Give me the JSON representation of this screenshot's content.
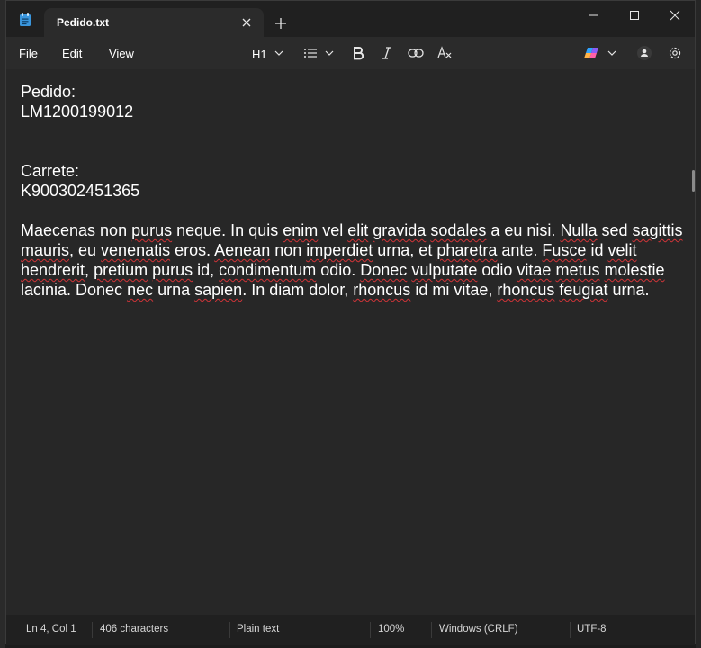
{
  "window": {
    "tab_title": "Pedido.txt"
  },
  "menu": {
    "file": "File",
    "edit": "Edit",
    "view": "View"
  },
  "toolbar": {
    "heading": "H1",
    "icons": [
      "list-icon",
      "bold-icon",
      "italic-icon",
      "link-icon",
      "clear-format-icon",
      "copilot-icon",
      "account-icon",
      "settings-icon"
    ]
  },
  "document": {
    "line1": "Pedido:",
    "line2": "LM1200199012",
    "line3": "Carrete:",
    "line4": "K900302451365",
    "paragraph": [
      {
        "t": "Maecenas non ",
        "sq": false
      },
      {
        "t": "purus",
        "sq": true
      },
      {
        "t": " neque. In quis ",
        "sq": false
      },
      {
        "t": "enim",
        "sq": true
      },
      {
        "t": " vel ",
        "sq": false
      },
      {
        "t": "elit",
        "sq": true
      },
      {
        "t": " ",
        "sq": false
      },
      {
        "t": "gravida",
        "sq": true
      },
      {
        "t": " ",
        "sq": false
      },
      {
        "t": "sodales",
        "sq": true
      },
      {
        "t": " a eu nisi. ",
        "sq": false
      },
      {
        "t": "Nulla",
        "sq": true
      },
      {
        "t": " sed ",
        "sq": false
      },
      {
        "t": "sagittis",
        "sq": true
      },
      {
        "t": " ",
        "sq": false
      },
      {
        "t": "mauris",
        "sq": true
      },
      {
        "t": ", eu ",
        "sq": false
      },
      {
        "t": "venenatis",
        "sq": true
      },
      {
        "t": " eros. ",
        "sq": false
      },
      {
        "t": "Aenean",
        "sq": true
      },
      {
        "t": " non ",
        "sq": false
      },
      {
        "t": "imperdiet",
        "sq": true
      },
      {
        "t": " urna, et ",
        "sq": false
      },
      {
        "t": "pharetra",
        "sq": true
      },
      {
        "t": " ante. ",
        "sq": false
      },
      {
        "t": "Fusce",
        "sq": true
      },
      {
        "t": " id ",
        "sq": false
      },
      {
        "t": "velit",
        "sq": true
      },
      {
        "t": " ",
        "sq": false
      },
      {
        "t": "hendrerit",
        "sq": true
      },
      {
        "t": ", ",
        "sq": false
      },
      {
        "t": "pretium",
        "sq": true
      },
      {
        "t": " ",
        "sq": false
      },
      {
        "t": "purus",
        "sq": true
      },
      {
        "t": " id, ",
        "sq": false
      },
      {
        "t": "condimentum",
        "sq": true
      },
      {
        "t": " odio. ",
        "sq": false
      },
      {
        "t": "Donec",
        "sq": true
      },
      {
        "t": " ",
        "sq": false
      },
      {
        "t": "vulputate",
        "sq": true
      },
      {
        "t": " odio ",
        "sq": false
      },
      {
        "t": "vitae",
        "sq": true
      },
      {
        "t": " ",
        "sq": false
      },
      {
        "t": "metus",
        "sq": true
      },
      {
        "t": " ",
        "sq": false
      },
      {
        "t": "molestie",
        "sq": true
      },
      {
        "t": " lacinia. Donec ",
        "sq": false
      },
      {
        "t": "nec",
        "sq": true
      },
      {
        "t": " urna ",
        "sq": false
      },
      {
        "t": "sapien",
        "sq": true
      },
      {
        "t": ". In diam dolor, ",
        "sq": false
      },
      {
        "t": "rhoncus",
        "sq": true
      },
      {
        "t": " id mi vitae, ",
        "sq": false
      },
      {
        "t": "rhoncus",
        "sq": true
      },
      {
        "t": " ",
        "sq": false
      },
      {
        "t": "feugiat",
        "sq": true
      },
      {
        "t": " urna.",
        "sq": false
      }
    ]
  },
  "status": {
    "position": "Ln 4, Col 1",
    "characters": "406 characters",
    "format": "Plain text",
    "zoom": "100%",
    "line_ending": "Windows (CRLF)",
    "encoding": "UTF-8"
  },
  "colors": {
    "spellcheck_underline": "#d13438",
    "editor_bg": "#272727",
    "chrome_bg": "#202020"
  }
}
